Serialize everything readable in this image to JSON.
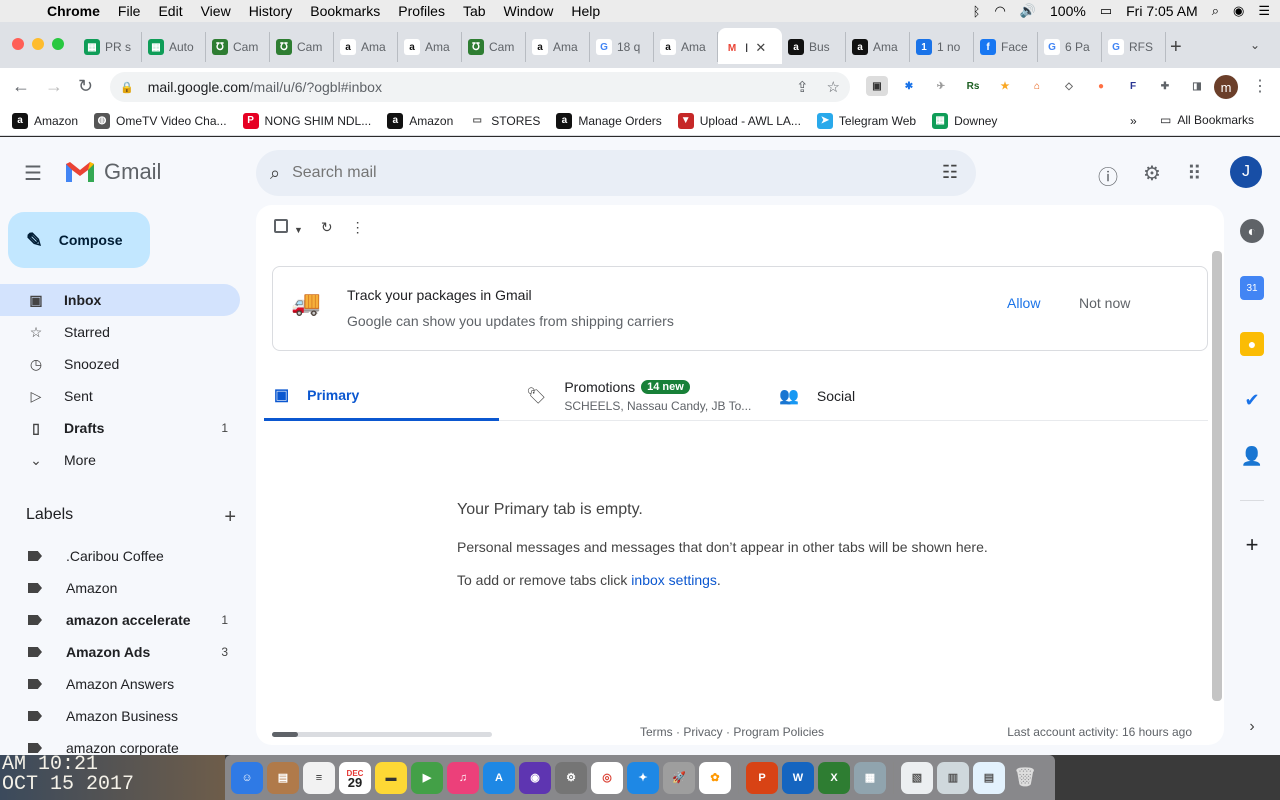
{
  "menubar": {
    "app": "Chrome",
    "items": [
      "File",
      "Edit",
      "View",
      "History",
      "Bookmarks",
      "Profiles",
      "Tab",
      "Window",
      "Help"
    ],
    "battery": "100%",
    "clock": "Fri 7:05 AM"
  },
  "tabs": [
    {
      "label": "PR s",
      "icon": "sheets-icon",
      "color": "#0f9d58"
    },
    {
      "label": "Auto",
      "icon": "sheets-icon",
      "color": "#0f9d58"
    },
    {
      "label": "Cam",
      "icon": "camelcamelcamel-icon",
      "color": "#2e7d32"
    },
    {
      "label": "Cam",
      "icon": "camelcamelcamel-icon",
      "color": "#2e7d32"
    },
    {
      "label": "Ama",
      "icon": "amazon-icon",
      "color": "#ffffff"
    },
    {
      "label": "Ama",
      "icon": "amazon-icon",
      "color": "#ffffff"
    },
    {
      "label": "Cam",
      "icon": "camelcamelcamel-icon",
      "color": "#2e7d32"
    },
    {
      "label": "Ama",
      "icon": "amazon-icon",
      "color": "#ffffff"
    },
    {
      "label": "18 q",
      "icon": "google-icon",
      "color": "#4285f4"
    },
    {
      "label": "Ama",
      "icon": "amazon-icon",
      "color": "#ffffff"
    },
    {
      "label": "I",
      "icon": "gmail-icon",
      "color": "#ea4335",
      "active": true
    },
    {
      "label": "Bus",
      "icon": "amazon-business-icon",
      "color": "#111111"
    },
    {
      "label": "Ama",
      "icon": "amazon-business-icon",
      "color": "#111111"
    },
    {
      "label": "1 no",
      "icon": "one-icon",
      "color": "#1a73e8"
    },
    {
      "label": "Face",
      "icon": "facebook-icon",
      "color": "#1877f2"
    },
    {
      "label": "6 Pa",
      "icon": "google-icon",
      "color": "#4285f4"
    },
    {
      "label": "RFS",
      "icon": "google-icon",
      "color": "#4285f4"
    }
  ],
  "address": {
    "host": "mail.google.com",
    "path": "/mail/u/6/?ogbl#inbox"
  },
  "bookmarks": [
    {
      "label": "Amazon",
      "icon": "amazon-icon"
    },
    {
      "label": "OmeTV Video Cha...",
      "icon": "globe-icon"
    },
    {
      "label": "NONG SHIM NDL...",
      "icon": "pinterest-icon"
    },
    {
      "label": "Amazon",
      "icon": "amazon-icon"
    },
    {
      "label": "STORES",
      "icon": "folder-icon"
    },
    {
      "label": "Manage Orders",
      "icon": "amazon-icon"
    },
    {
      "label": "Upload - AWL LA...",
      "icon": "awl-icon"
    },
    {
      "label": "Telegram Web",
      "icon": "telegram-icon"
    },
    {
      "label": "Downey",
      "icon": "sheets-icon"
    }
  ],
  "bookmarks_more": "»",
  "all_bookmarks": "All Bookmarks",
  "gmail": {
    "brand": "Gmail",
    "search_placeholder": "Search mail",
    "avatar_letter": "J",
    "compose": "Compose",
    "nav": [
      {
        "label": "Inbox",
        "icon": "inbox-icon",
        "active": true,
        "count": ""
      },
      {
        "label": "Starred",
        "icon": "star-icon",
        "count": ""
      },
      {
        "label": "Snoozed",
        "icon": "clock-icon",
        "count": ""
      },
      {
        "label": "Sent",
        "icon": "send-icon",
        "count": ""
      },
      {
        "label": "Drafts",
        "icon": "draft-icon",
        "count": "1",
        "bold": true
      },
      {
        "label": "More",
        "icon": "chevron-down-icon",
        "count": ""
      }
    ],
    "labels_title": "Labels",
    "labels": [
      {
        "label": ".Caribou Coffee",
        "count": ""
      },
      {
        "label": "Amazon",
        "count": ""
      },
      {
        "label": "amazon accelerate",
        "count": "1",
        "bold": true
      },
      {
        "label": "Amazon Ads",
        "count": "3",
        "bold": true
      },
      {
        "label": "Amazon Answers",
        "count": ""
      },
      {
        "label": "Amazon Business",
        "count": ""
      },
      {
        "label": "amazon corporate",
        "count": ""
      }
    ],
    "banner": {
      "title": "Track your packages in Gmail",
      "subtitle": "Google can show you updates from shipping carriers",
      "allow": "Allow",
      "not_now": "Not now"
    },
    "tabs": {
      "primary": "Primary",
      "promotions": "Promotions",
      "promotions_badge": "14 new",
      "promotions_sub": "SCHEELS, Nassau Candy, JB To...",
      "social": "Social"
    },
    "empty": {
      "title": "Your Primary tab is empty.",
      "desc": "Personal messages and messages that don’t appear in other tabs will be shown here.",
      "settings_prefix": "To add or remove tabs click ",
      "settings_link": "inbox settings",
      "settings_suffix": "."
    },
    "footer": {
      "links": "Terms · Privacy · Program Policies",
      "last_activity": "Last account activity: 16 hours ago"
    }
  },
  "desktop": {
    "stamp_line1": "AM 10:21",
    "stamp_line2": "OCT 15 2017"
  },
  "dock": {
    "calendar_day": "29",
    "calendar_month": "DEC"
  },
  "colors": {
    "accent": "#0b57d0",
    "compose_bg": "#c2e7ff",
    "nav_active": "#d3e3fd",
    "badge_green": "#188038",
    "link_blue": "#1a73e8"
  }
}
